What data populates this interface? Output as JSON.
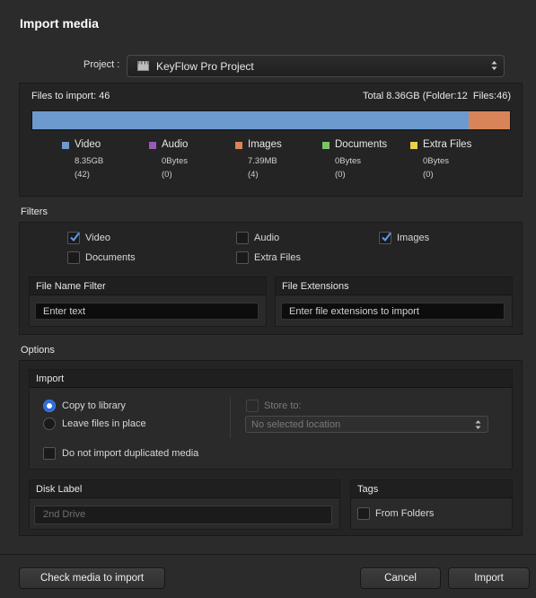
{
  "dialog": {
    "title": "Import media"
  },
  "project": {
    "label": "Project :",
    "value": "KeyFlow Pro Project"
  },
  "summary": {
    "files_to_import": "Files to import: 46",
    "total": "Total 8.36GB (Folder:12",
    "files": "Files:46)",
    "bar": {
      "video_fraction": 0.913,
      "images_fraction": 0.087,
      "video_color": "#6c9acf",
      "images_color": "#d98458"
    },
    "legend": [
      {
        "name": "Video",
        "size": "8.35GB",
        "count": "(42)",
        "color": "#6c9acf"
      },
      {
        "name": "Audio",
        "size": "0Bytes",
        "count": "(0)",
        "color": "#9b59b6"
      },
      {
        "name": "Images",
        "size": "7.39MB",
        "count": "(4)",
        "color": "#d98458"
      },
      {
        "name": "Documents",
        "size": "0Bytes",
        "count": "(0)",
        "color": "#7cc26b"
      },
      {
        "name": "Extra Files",
        "size": "0Bytes",
        "count": "(0)",
        "color": "#e8d34a"
      }
    ]
  },
  "filters": {
    "title": "Filters",
    "types": [
      {
        "label": "Video",
        "checked": true
      },
      {
        "label": "Audio",
        "checked": false
      },
      {
        "label": "Images",
        "checked": true
      },
      {
        "label": "Documents",
        "checked": false
      },
      {
        "label": "Extra Files",
        "checked": false
      }
    ],
    "file_name_filter": {
      "title": "File Name Filter",
      "placeholder": "Enter text"
    },
    "file_extensions": {
      "title": "File Extensions",
      "placeholder": "Enter file extensions to import"
    }
  },
  "options": {
    "title": "Options",
    "import": {
      "title": "Import",
      "copy_label": "Copy to library",
      "leave_label": "Leave files in place",
      "selected": "copy",
      "store_to_label": "Store to:",
      "location_placeholder": "No selected location",
      "no_duplicates_label": "Do not import duplicated media"
    },
    "disk_label": {
      "title": "Disk Label",
      "placeholder": "2nd Drive"
    },
    "tags": {
      "title": "Tags",
      "from_folders_label": "From Folders"
    }
  },
  "buttons": {
    "check": "Check media to import",
    "cancel": "Cancel",
    "import": "Import"
  },
  "colors": {
    "accent": "#2e6bd6",
    "background": "#2b2b2b"
  }
}
